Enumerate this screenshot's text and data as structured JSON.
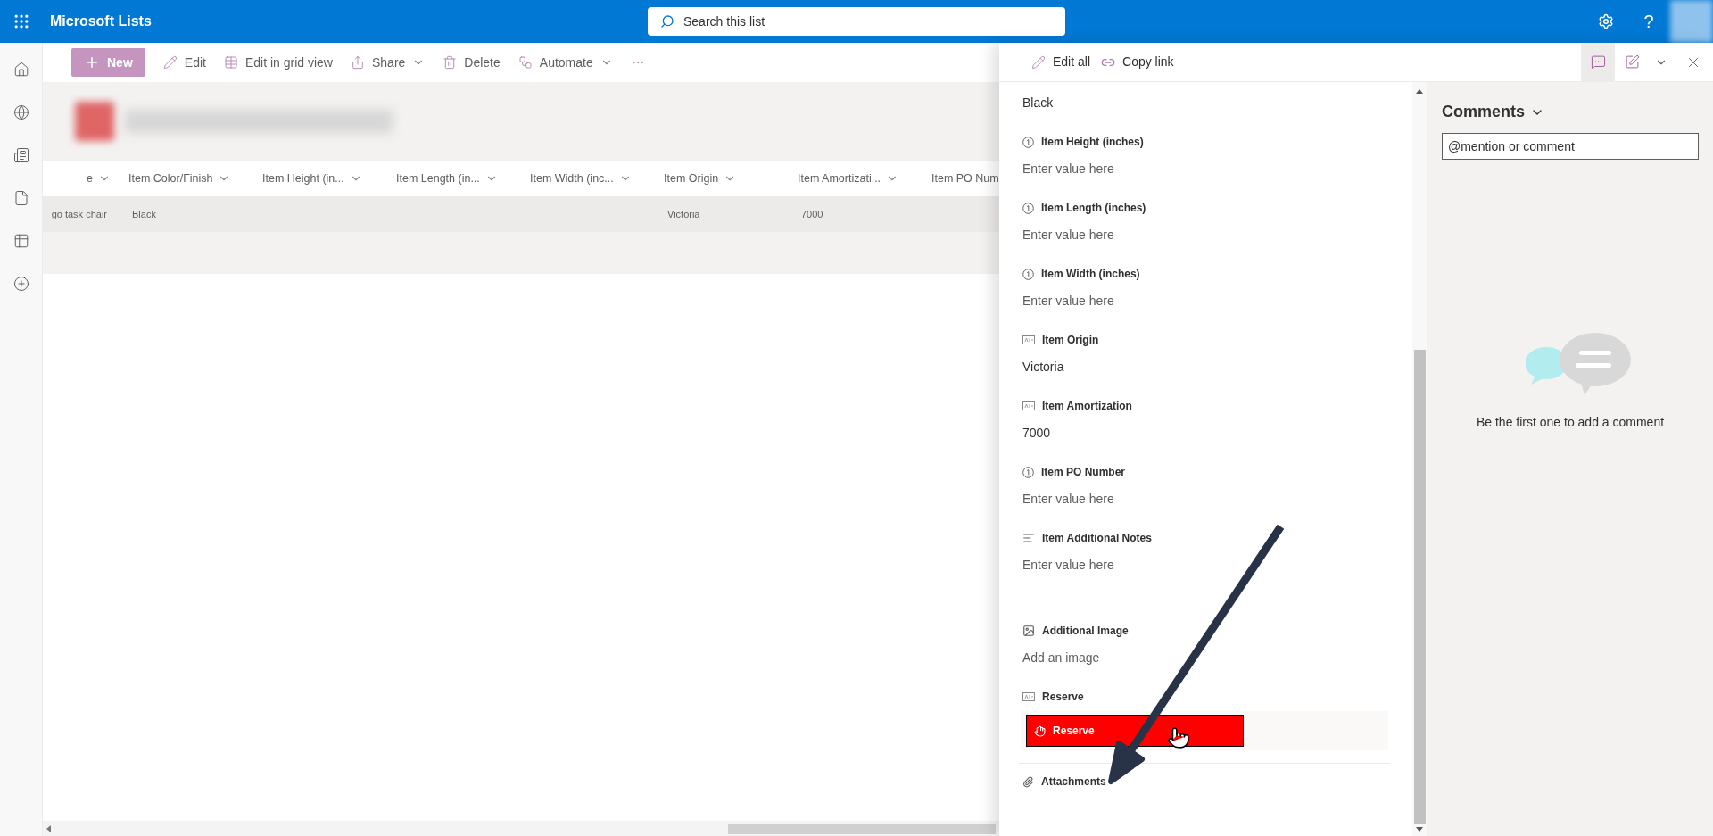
{
  "app": {
    "title": "Microsoft Lists",
    "help": "?"
  },
  "search": {
    "placeholder": "Search this list"
  },
  "toolbar": [
    {
      "kind": "new",
      "label": "New",
      "dropdown": false
    },
    {
      "kind": "edit",
      "label": "Edit",
      "dropdown": false
    },
    {
      "kind": "grid",
      "label": "Edit in grid view",
      "dropdown": false
    },
    {
      "kind": "share",
      "label": "Share",
      "dropdown": true
    },
    {
      "kind": "delete",
      "label": "Delete",
      "dropdown": false
    },
    {
      "kind": "automate",
      "label": "Automate",
      "dropdown": true
    },
    {
      "kind": "more",
      "dropdown": false
    }
  ],
  "rail": [
    {
      "kind": "home",
      "selected": false
    },
    {
      "kind": "globe",
      "selected": false
    },
    {
      "kind": "news",
      "selected": false
    },
    {
      "kind": "file",
      "selected": false
    },
    {
      "kind": "list",
      "selected": false
    },
    {
      "kind": "add",
      "selected": false
    }
  ],
  "table": {
    "columns": [
      {
        "label": "e",
        "menu": true
      },
      {
        "label": "Item Color/Finish",
        "menu": true
      },
      {
        "label": "Item Height (in...",
        "menu": true
      },
      {
        "label": "Item Length (in...",
        "menu": true
      },
      {
        "label": "Item Width (inc...",
        "menu": true
      },
      {
        "label": "Item Origin",
        "menu": true
      },
      {
        "label": "Item Amortizati...",
        "menu": true
      },
      {
        "label": "Item PO Num"
      }
    ],
    "rows": [
      {
        "selected": true,
        "cells": [
          "go task chair",
          "Black",
          null,
          null,
          null,
          "Victoria",
          "7000",
          null
        ]
      }
    ]
  },
  "panel": {
    "actions": [
      {
        "kind": "edit",
        "label": "Edit all"
      },
      {
        "kind": "link",
        "label": "Copy link"
      }
    ],
    "views": [
      {
        "kind": "comments",
        "selected": true
      },
      {
        "kind": "form",
        "selected": false
      }
    ],
    "fields": [
      {
        "kind": "text",
        "value": "Black"
      },
      {
        "kind": "number",
        "label": "Item Height (inches)",
        "placeholder": "Enter value here"
      },
      {
        "kind": "number",
        "label": "Item Length (inches)",
        "placeholder": "Enter value here"
      },
      {
        "kind": "number",
        "label": "Item Width (inches)",
        "placeholder": "Enter value here"
      },
      {
        "kind": "text",
        "label": "Item Origin",
        "value": "Victoria"
      },
      {
        "kind": "text",
        "label": "Item Amortization",
        "value": "7000"
      },
      {
        "kind": "number",
        "label": "Item PO Number",
        "placeholder": "Enter value here"
      },
      {
        "kind": "notes",
        "label": "Item Additional Notes",
        "placeholder": "Enter value here"
      },
      {
        "kind": "image",
        "label": "Additional Image",
        "placeholder": "Add an image"
      },
      {
        "kind": "button",
        "label": "Reserve",
        "button_label": "Reserve",
        "color": "#ff0000"
      }
    ],
    "attachments": {
      "label": "Attachments"
    }
  },
  "comments": {
    "title": "Comments",
    "placeholder": "@mention or comment",
    "empty_text": "Be the first one to add a comment"
  }
}
